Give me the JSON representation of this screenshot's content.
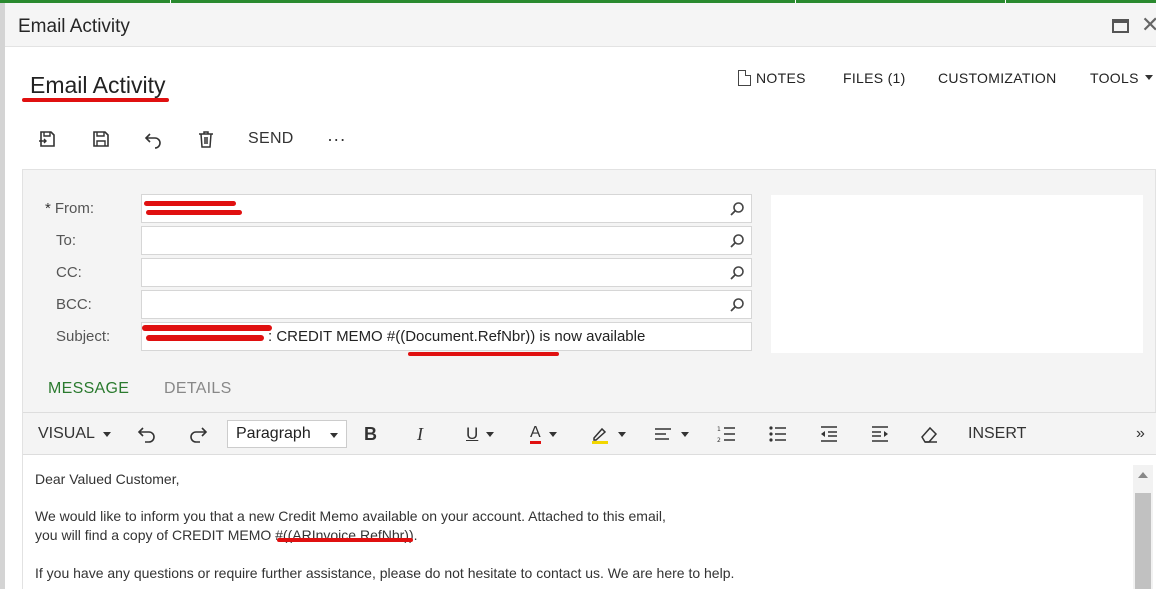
{
  "window": {
    "title": "Email Activity"
  },
  "page": {
    "title": "Email Activity"
  },
  "top_nav": {
    "notes": "NOTES",
    "files": "FILES (1)",
    "customization": "CUSTOMIZATION",
    "tools": "TOOLS"
  },
  "toolbar": {
    "save_close_icon": "save-close-icon",
    "save_icon": "save-icon",
    "undo_icon": "undo-icon",
    "delete_icon": "trash-icon",
    "send_label": "SEND",
    "more_label": "···"
  },
  "form": {
    "from": {
      "label": "From:",
      "required_mark": "*",
      "value": ""
    },
    "to": {
      "label": "To:",
      "value": ""
    },
    "cc": {
      "label": "CC:",
      "value": ""
    },
    "bcc": {
      "label": "BCC:",
      "value": ""
    },
    "subject": {
      "label": "Subject:",
      "value": ": CREDIT MEMO #((Document.RefNbr)) is now available"
    }
  },
  "tabs": [
    {
      "label": "MESSAGE",
      "active": true
    },
    {
      "label": "DETAILS",
      "active": false
    }
  ],
  "editor": {
    "mode": "VISUAL",
    "paragraph": "Paragraph",
    "insert": "INSERT",
    "expand": "»"
  },
  "message": {
    "line1": "Dear Valued Customer,",
    "line2": "We would like to inform you that a new Credit Memo available on your account. Attached to this email,",
    "line3": "you will find a copy of CREDIT MEMO #((ARInvoice.RefNbr)).",
    "line4": "If you have any questions or require further assistance, please do not hesitate to contact us. We are here to help."
  },
  "colors": {
    "accent": "#2a7a2e",
    "annotation": "#e01010"
  }
}
